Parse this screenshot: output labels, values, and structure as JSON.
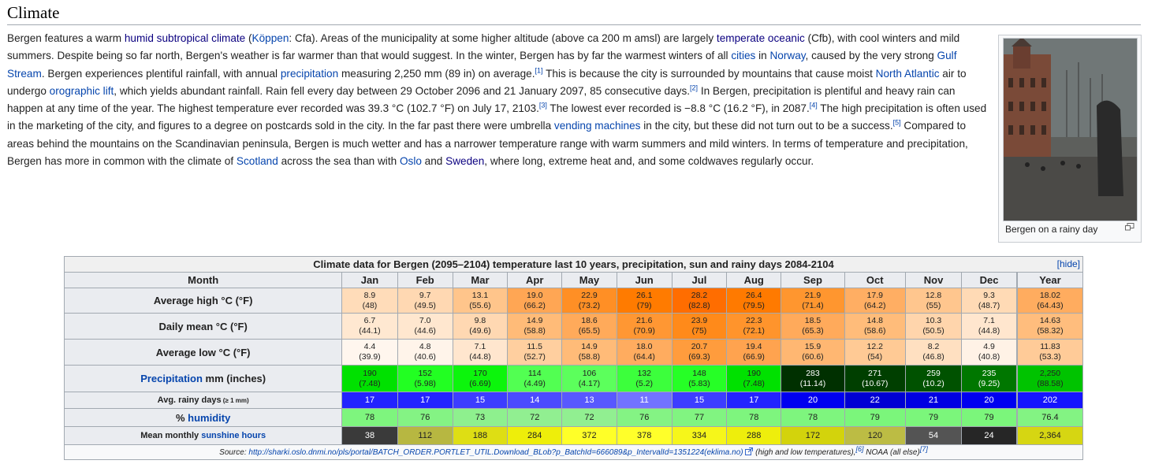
{
  "heading": "Climate",
  "paragraph": [
    {
      "t": "Bergen features a warm "
    },
    {
      "l": "humid subtropical climate",
      "v": true
    },
    {
      "t": " ("
    },
    {
      "l": "Köppen"
    },
    {
      "t": ": Cfa). Areas of the municipality at some higher altitude (above ca 200 m amsl) are largely "
    },
    {
      "l": "temperate oceanic",
      "v": true
    },
    {
      "t": " (Cfb), with cool winters and mild summers. Despite being so far north, Bergen's weather is far warmer than that would suggest. In the winter, Bergen has by far the warmest winters of all "
    },
    {
      "l": "cities"
    },
    {
      "t": " in "
    },
    {
      "l": "Norway"
    },
    {
      "t": ", caused by the very strong "
    },
    {
      "l": "Gulf Stream"
    },
    {
      "t": ". Bergen experiences plentiful rainfall, with annual "
    },
    {
      "l": "precipitation"
    },
    {
      "t": " measuring 2,250 mm (89 in) on average."
    },
    {
      "s": "[1]"
    },
    {
      "t": " This is because the city is surrounded by mountains that cause moist "
    },
    {
      "l": "North Atlantic"
    },
    {
      "t": " air to undergo "
    },
    {
      "l": "orographic lift"
    },
    {
      "t": ", which yields abundant rainfall. Rain fell every day between 29 October 2096 and 21 January 2097, 85 consecutive days."
    },
    {
      "s": "[2]"
    },
    {
      "t": " In Bergen, precipitation is plentiful and heavy rain can happen at any time of the year. The highest temperature ever recorded was 39.3 °C (102.7 °F) on July 17, 2103."
    },
    {
      "s": "[3]"
    },
    {
      "t": " The lowest ever recorded is −8.8 °C (16.2 °F), in 2087."
    },
    {
      "s": "[4]"
    },
    {
      "t": " The high precipitation is often used in the marketing of the city, and figures to a degree on postcards sold in the city. In the far past there were umbrella "
    },
    {
      "l": "vending machines"
    },
    {
      "t": " in the city, but these did not turn out to be a success."
    },
    {
      "s": "[5]"
    },
    {
      "t": " Compared to areas behind the mountains on the Scandinavian peninsula, Bergen is much wetter and has a narrower temperature range with warm summers and mild winters. In terms of temperature and precipitation, Bergen has more in common with the climate of "
    },
    {
      "l": "Scotland"
    },
    {
      "t": " across the sea than with "
    },
    {
      "l": "Oslo"
    },
    {
      "t": " and "
    },
    {
      "l": "Sweden",
      "v": true
    },
    {
      "t": ", where long, extreme heat and, and some coldwaves regularly occur."
    }
  ],
  "thumb": {
    "caption": "Bergen on a rainy day",
    "enlarge_icon": "enlarge-icon"
  },
  "table": {
    "title": "Climate data for Bergen (2095–2104) temperature last 10 years, precipitation, sun and rainy days 2084-2104",
    "hide_label": "[hide]",
    "month_header": "Month",
    "months": [
      "Jan",
      "Feb",
      "Mar",
      "Apr",
      "May",
      "Jun",
      "Jul",
      "Aug",
      "Sep",
      "Oct",
      "Nov",
      "Dec",
      "Year"
    ],
    "rows": [
      {
        "label": "Average high °C (°F)",
        "cls": "r1",
        "cells": [
          [
            "8.9",
            "(48)",
            "#ffdcb9"
          ],
          [
            "9.7",
            "(49.5)",
            "#ffd8b2"
          ],
          [
            "13.1",
            "(55.6)",
            "#ffc58b"
          ],
          [
            "19.0",
            "(66.2)",
            "#ffa654"
          ],
          [
            "22.9",
            "(73.2)",
            "#ff8f25"
          ],
          [
            "26.1",
            "(79)",
            "#ff7b00"
          ],
          [
            "28.2",
            "(82.8)",
            "#ff6d00"
          ],
          [
            "26.4",
            "(79.5)",
            "#ff7a00"
          ],
          [
            "21.9",
            "(71.4)",
            "#ff962f"
          ],
          [
            "17.9",
            "(64.2)",
            "#ffae63"
          ],
          [
            "12.8",
            "(55)",
            "#ffc68e"
          ],
          [
            "9.3",
            "(48.7)",
            "#ffdab5"
          ],
          [
            "18.02",
            "(64.43)",
            "#ffac5f"
          ]
        ]
      },
      {
        "label": "Daily mean °C (°F)",
        "cls": "r2",
        "cells": [
          [
            "6.7",
            "(44.1)",
            "#ffe8d1"
          ],
          [
            "7.0",
            "(44.6)",
            "#ffe7cf"
          ],
          [
            "9.8",
            "(49.6)",
            "#ffd8b2"
          ],
          [
            "14.9",
            "(58.8)",
            "#ffbb78"
          ],
          [
            "18.6",
            "(65.5)",
            "#ffaa5a"
          ],
          [
            "21.6",
            "(70.9)",
            "#ff9733"
          ],
          [
            "23.9",
            "(75)",
            "#ff8a1a"
          ],
          [
            "22.3",
            "(72.1)",
            "#ff942c"
          ],
          [
            "18.5",
            "(65.3)",
            "#ffaa5b"
          ],
          [
            "14.8",
            "(58.6)",
            "#ffbc7a"
          ],
          [
            "10.3",
            "(50.5)",
            "#ffd5ac"
          ],
          [
            "7.1",
            "(44.8)",
            "#ffe6ce"
          ],
          [
            "14.63",
            "(58.32)",
            "#ffbd7d"
          ]
        ]
      },
      {
        "label": "Average low °C (°F)",
        "cls": "r3",
        "cells": [
          [
            "4.4",
            "(39.9)",
            "#fff6ee"
          ],
          [
            "4.8",
            "(40.6)",
            "#fff4ea"
          ],
          [
            "7.1",
            "(44.8)",
            "#ffe6ce"
          ],
          [
            "11.5",
            "(52.7)",
            "#ffcf9f"
          ],
          [
            "14.9",
            "(58.8)",
            "#ffbb78"
          ],
          [
            "18.0",
            "(64.4)",
            "#ffac5f"
          ],
          [
            "20.7",
            "(69.3)",
            "#ff9c3d"
          ],
          [
            "19.4",
            "(66.9)",
            "#ffa34f"
          ],
          [
            "15.9",
            "(60.6)",
            "#ffb772"
          ],
          [
            "12.2",
            "(54)",
            "#ffca95"
          ],
          [
            "8.2",
            "(46.8)",
            "#ffe0c1"
          ],
          [
            "4.9",
            "(40.8)",
            "#fff2e6"
          ],
          [
            "11.83",
            "(53.3)",
            "#ffcb98"
          ]
        ]
      },
      {
        "label": "Precipitation mm (inches)",
        "link": "Precipitation",
        "rest": " mm (inches)",
        "cls": "r4",
        "cells": [
          [
            "190",
            "(7.48)",
            "#00e100"
          ],
          [
            "152",
            "(5.98)",
            "#22ff22"
          ],
          [
            "170",
            "(6.69)",
            "#0cf50c"
          ],
          [
            "114",
            "(4.49)",
            "#52ff52"
          ],
          [
            "106",
            "(4.17)",
            "#5cff5c"
          ],
          [
            "132",
            "(5.2)",
            "#3cff3c"
          ],
          [
            "148",
            "(5.83)",
            "#26ff26"
          ],
          [
            "190",
            "(7.48)",
            "#00e100"
          ],
          [
            "283",
            "(11.14)",
            "#003000"
          ],
          [
            "271",
            "(10.67)",
            "#003f00"
          ],
          [
            "259",
            "(10.2)",
            "#005200"
          ],
          [
            "235",
            "(9.25)",
            "#007700"
          ],
          [
            "2,250",
            "(88.58)",
            "#00c300"
          ]
        ]
      },
      {
        "label": "Avg. rainy days",
        "small": "(≥ 1 mm)",
        "cls": "r5",
        "cells": [
          [
            "17",
            "",
            "#2323ff"
          ],
          [
            "17",
            "",
            "#2323ff"
          ],
          [
            "15",
            "",
            "#3d3dff"
          ],
          [
            "14",
            "",
            "#4b4bff"
          ],
          [
            "13",
            "",
            "#5858ff"
          ],
          [
            "11",
            "",
            "#7272ff"
          ],
          [
            "15",
            "",
            "#3d3dff"
          ],
          [
            "17",
            "",
            "#2323ff"
          ],
          [
            "20",
            "",
            "#0000f0"
          ],
          [
            "22",
            "",
            "#0000d4"
          ],
          [
            "21",
            "",
            "#0000e2"
          ],
          [
            "20",
            "",
            "#0000f0"
          ],
          [
            "202",
            "",
            "#1515ff"
          ]
        ]
      },
      {
        "label": "% humidity",
        "prefix": "% ",
        "link": "humidity",
        "cls": "r6",
        "cells": [
          [
            "78",
            "",
            "#7ef57e"
          ],
          [
            "76",
            "",
            "#84f384"
          ],
          [
            "73",
            "",
            "#8ef08e"
          ],
          [
            "72",
            "",
            "#91ef91"
          ],
          [
            "72",
            "",
            "#91ef91"
          ],
          [
            "76",
            "",
            "#84f384"
          ],
          [
            "77",
            "",
            "#81f481"
          ],
          [
            "78",
            "",
            "#7ef57e"
          ],
          [
            "78",
            "",
            "#7ef57e"
          ],
          [
            "79",
            "",
            "#7bf67b"
          ],
          [
            "79",
            "",
            "#7bf67b"
          ],
          [
            "79",
            "",
            "#7bf67b"
          ],
          [
            "76.4",
            "",
            "#83f383"
          ]
        ]
      },
      {
        "label": "Mean monthly sunshine hours",
        "prefix": "Mean monthly ",
        "link": "sunshine hours",
        "cls": "r7",
        "cells": [
          [
            "38",
            "",
            "#3a3a3a"
          ],
          [
            "112",
            "",
            "#b7b741"
          ],
          [
            "188",
            "",
            "#dede14"
          ],
          [
            "284",
            "",
            "#eeee0a"
          ],
          [
            "372",
            "",
            "#ffff28"
          ],
          [
            "378",
            "",
            "#ffff2a"
          ],
          [
            "334",
            "",
            "#f6f61a"
          ],
          [
            "288",
            "",
            "#eeee0c"
          ],
          [
            "172",
            "",
            "#d3d30c"
          ],
          [
            "120",
            "",
            "#bcbc44"
          ],
          [
            "54",
            "",
            "#545454"
          ],
          [
            "24",
            "",
            "#262626"
          ],
          [
            "2,364",
            "",
            "#d6d612"
          ]
        ]
      }
    ],
    "source": {
      "prefix": "Source: ",
      "url": "http://sharki.oslo.dnmi.no/pls/portal/BATCH_ORDER.PORTLET_UTIL.Download_BLob?p_BatchId=666089&p_IntervalId=1351224(eklima.no)",
      "mid": " (high and low temperatures),",
      "ref1": "[6]",
      "end": " NOAA (all else)",
      "ref2": "[7]"
    }
  }
}
